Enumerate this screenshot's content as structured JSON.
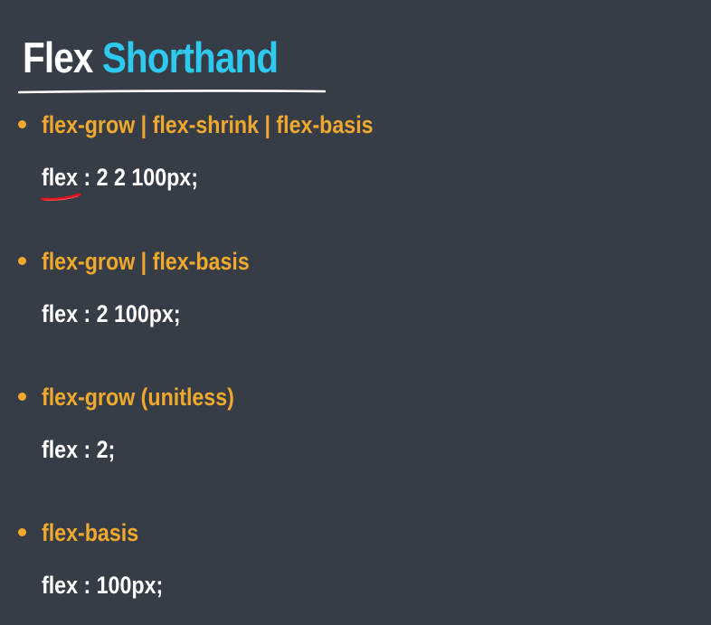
{
  "slide": {
    "title_part1": "Flex",
    "title_part2": "Shorthand",
    "items": [
      {
        "bullet": "flex-grow | flex-shrink | flex-basis",
        "code": "flex : 2 2 100px;"
      },
      {
        "bullet": "flex-grow | flex-basis",
        "code": "flex : 2 100px;"
      },
      {
        "bullet": "flex-grow (unitless)",
        "code": "flex : 2;"
      },
      {
        "bullet": "flex-basis",
        "code": "flex : 100px;"
      }
    ]
  },
  "colors": {
    "background": "#373d46",
    "title_primary": "#ffffff",
    "title_accent": "#2ec9ee",
    "bullet": "#f0a92c",
    "code": "#ffffff",
    "annotation": "#e0121c"
  },
  "icons": {
    "bullet": "bullet-dot-icon",
    "annotation": "red-underline-annotation"
  }
}
